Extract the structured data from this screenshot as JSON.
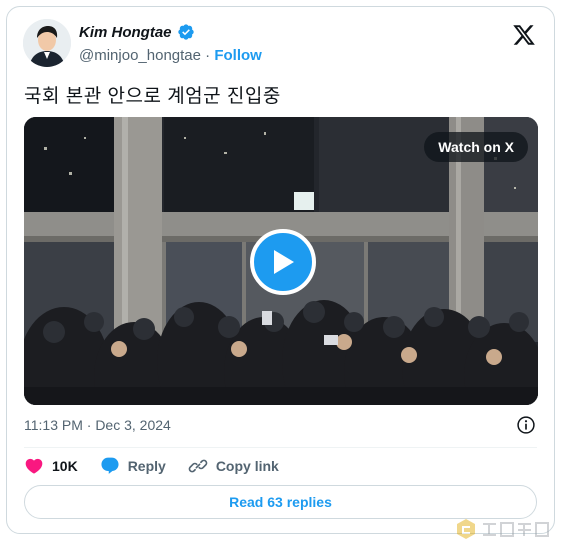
{
  "author": {
    "display_name": "Kim Hongtae",
    "handle": "@minjoo_hongtae",
    "separator": "·",
    "follow_label": "Follow"
  },
  "tweet": {
    "text": "국회 본관 안으로 계엄군 진입중",
    "timestamp": "11:13 PM · Dec 3, 2024"
  },
  "media": {
    "watch_label": "Watch on X"
  },
  "actions": {
    "like_count": "10K",
    "reply_label": "Reply",
    "copy_label": "Copy link"
  },
  "replies_button": "Read 63 replies",
  "colors": {
    "accent": "#1d9bf0",
    "like": "#f91880",
    "muted": "#536471",
    "text": "#0f1419",
    "border": "#cfd9de"
  },
  "icons": [
    "verified-badge-icon",
    "x-logo-icon",
    "play-icon",
    "info-icon",
    "heart-icon",
    "reply-bubble-icon",
    "link-icon",
    "watermark-logo-icon"
  ]
}
